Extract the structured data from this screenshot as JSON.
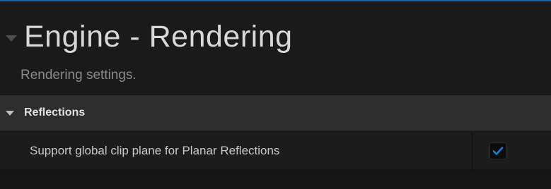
{
  "header": {
    "title": "Engine - Rendering",
    "subtitle": "Rendering settings."
  },
  "section": {
    "label": "Reflections",
    "icon": "triangle-down-icon"
  },
  "settings": [
    {
      "label": "Support global clip plane for Planar Reflections",
      "checked": true
    }
  ],
  "colors": {
    "accent": "#1f7ad6",
    "top_border": "#1d5fa5",
    "background": "#151515"
  }
}
